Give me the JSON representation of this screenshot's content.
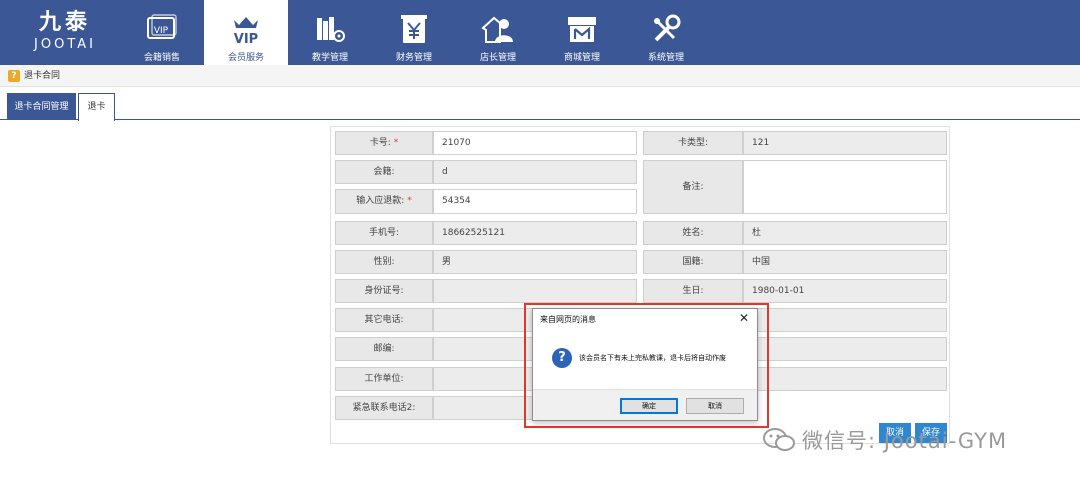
{
  "brand": {
    "cn": "九泰",
    "en": "JOOTAI"
  },
  "nav": [
    {
      "label": "会籍销售",
      "icon": "vip-card-icon",
      "active": false
    },
    {
      "label": "会员服务",
      "icon": "vip-crown-icon",
      "active": true
    },
    {
      "label": "教学管理",
      "icon": "books-gear-icon",
      "active": false
    },
    {
      "label": "财务管理",
      "icon": "yen-box-icon",
      "active": false
    },
    {
      "label": "店长管理",
      "icon": "manager-house-icon",
      "active": false
    },
    {
      "label": "商城管理",
      "icon": "shop-icon",
      "active": false
    },
    {
      "label": "系统管理",
      "icon": "tools-icon",
      "active": false
    }
  ],
  "nav_vip_text": "VIP",
  "breadcrumb": {
    "icon_glyph": "?",
    "text": "退卡合同"
  },
  "tabs": [
    {
      "label": "退卡合同管理"
    },
    {
      "label": "退卡"
    }
  ],
  "form": {
    "card_no_label": "卡号:",
    "card_no_value": "21070",
    "card_type_label": "卡类型:",
    "card_type_value": "121",
    "membership_label": "会籍:",
    "membership_value": "d",
    "remark_label": "备注:",
    "remark_value": "",
    "refund_label": "输入应退款:",
    "refund_value": "54354",
    "phone_label": "手机号:",
    "phone_value": "18662525121",
    "name_label": "姓名:",
    "name_value": "杜",
    "gender_label": "性别:",
    "gender_value": "男",
    "nationality_label": "国籍:",
    "nationality_value": "中国",
    "id_label": "身份证号:",
    "id_value": "",
    "birthday_label": "生日:",
    "birthday_value": "1980-01-01",
    "other_phone_label": "其它电话:",
    "email_label": "邮编:",
    "work_label": "工作单位:",
    "emergency_label": "紧急联系电话2:",
    "btn_cancel": "取消",
    "btn_save": "保存"
  },
  "dialog": {
    "title": "来自网页的消息",
    "close_glyph": "✕",
    "message": "该会员名下有未上完私教课，退卡后将自动作废",
    "ok": "确定",
    "cancel": "取消"
  },
  "watermark": {
    "text": "微信号: Jootai-GYM"
  },
  "colors": {
    "nav_bg": "#3b5796",
    "accent_red": "#e0392b",
    "button_blue": "#2f86d1"
  }
}
